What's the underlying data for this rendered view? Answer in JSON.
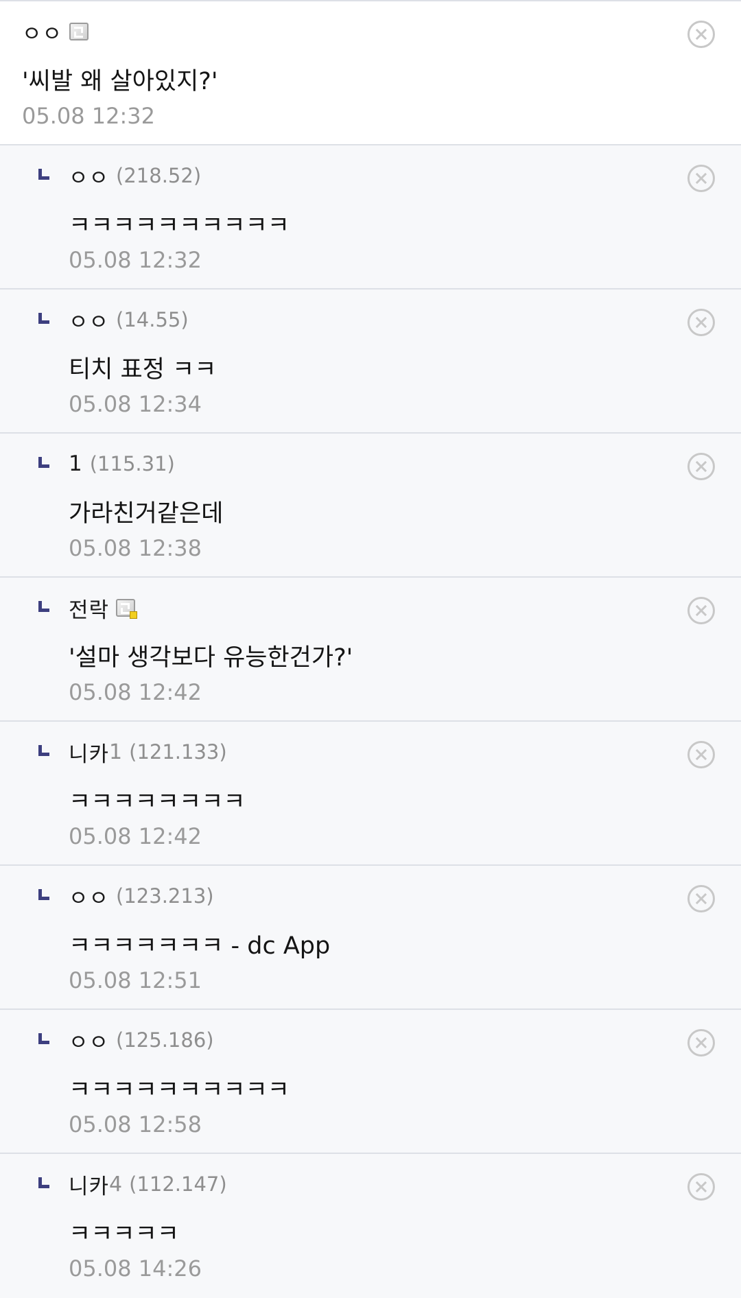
{
  "comments": [
    {
      "nick": "ㅇㅇ",
      "nick_suffix": "",
      "ip": "",
      "icon": "gallog-icon",
      "body": "'씨발 왜 살아있지?'",
      "date": "05.08 12:32"
    },
    {
      "nick": "ㅇㅇ",
      "nick_suffix": "",
      "ip": "(218.52)",
      "body": "ㅋㅋㅋㅋㅋㅋㅋㅋㅋㅋ",
      "date": "05.08 12:32"
    },
    {
      "nick": "ㅇㅇ",
      "nick_suffix": "",
      "ip": "(14.55)",
      "body": "티치 표정 ㅋㅋ",
      "date": "05.08 12:34"
    },
    {
      "nick": "1",
      "nick_suffix": "",
      "ip": "(115.31)",
      "body": "가라친거같은데",
      "date": "05.08 12:38"
    },
    {
      "nick": "전락",
      "nick_suffix": "",
      "ip": "",
      "icon": "gallog-icon",
      "body": "'설마 생각보다 유능한건가?'",
      "date": "05.08 12:42"
    },
    {
      "nick": "니카",
      "nick_suffix": "1",
      "ip": "(121.133)",
      "body": "ㅋㅋㅋㅋㅋㅋㅋㅋ",
      "date": "05.08 12:42"
    },
    {
      "nick": "ㅇㅇ",
      "nick_suffix": "",
      "ip": "(123.213)",
      "body": "ㅋㅋㅋㅋㅋㅋㅋ - dc App",
      "date": "05.08 12:51"
    },
    {
      "nick": "ㅇㅇ",
      "nick_suffix": "",
      "ip": "(125.186)",
      "body": "ㅋㅋㅋㅋㅋㅋㅋㅋㅋㅋ",
      "date": "05.08 12:58"
    },
    {
      "nick": "니카",
      "nick_suffix": "4",
      "ip": "(112.147)",
      "body": "ㅋㅋㅋㅋㅋ",
      "date": "05.08 14:26"
    }
  ],
  "icons": {
    "reply": "reply-arrow-icon",
    "delete": "close-circle-icon",
    "gallog": "gallog-icon"
  },
  "colors": {
    "reply_mark": "#3d3f7f",
    "badge": "#f2cf1f",
    "date_text": "#9a9a9a",
    "reply_background": "#f7f8fa",
    "top_background": "#ffffff"
  }
}
